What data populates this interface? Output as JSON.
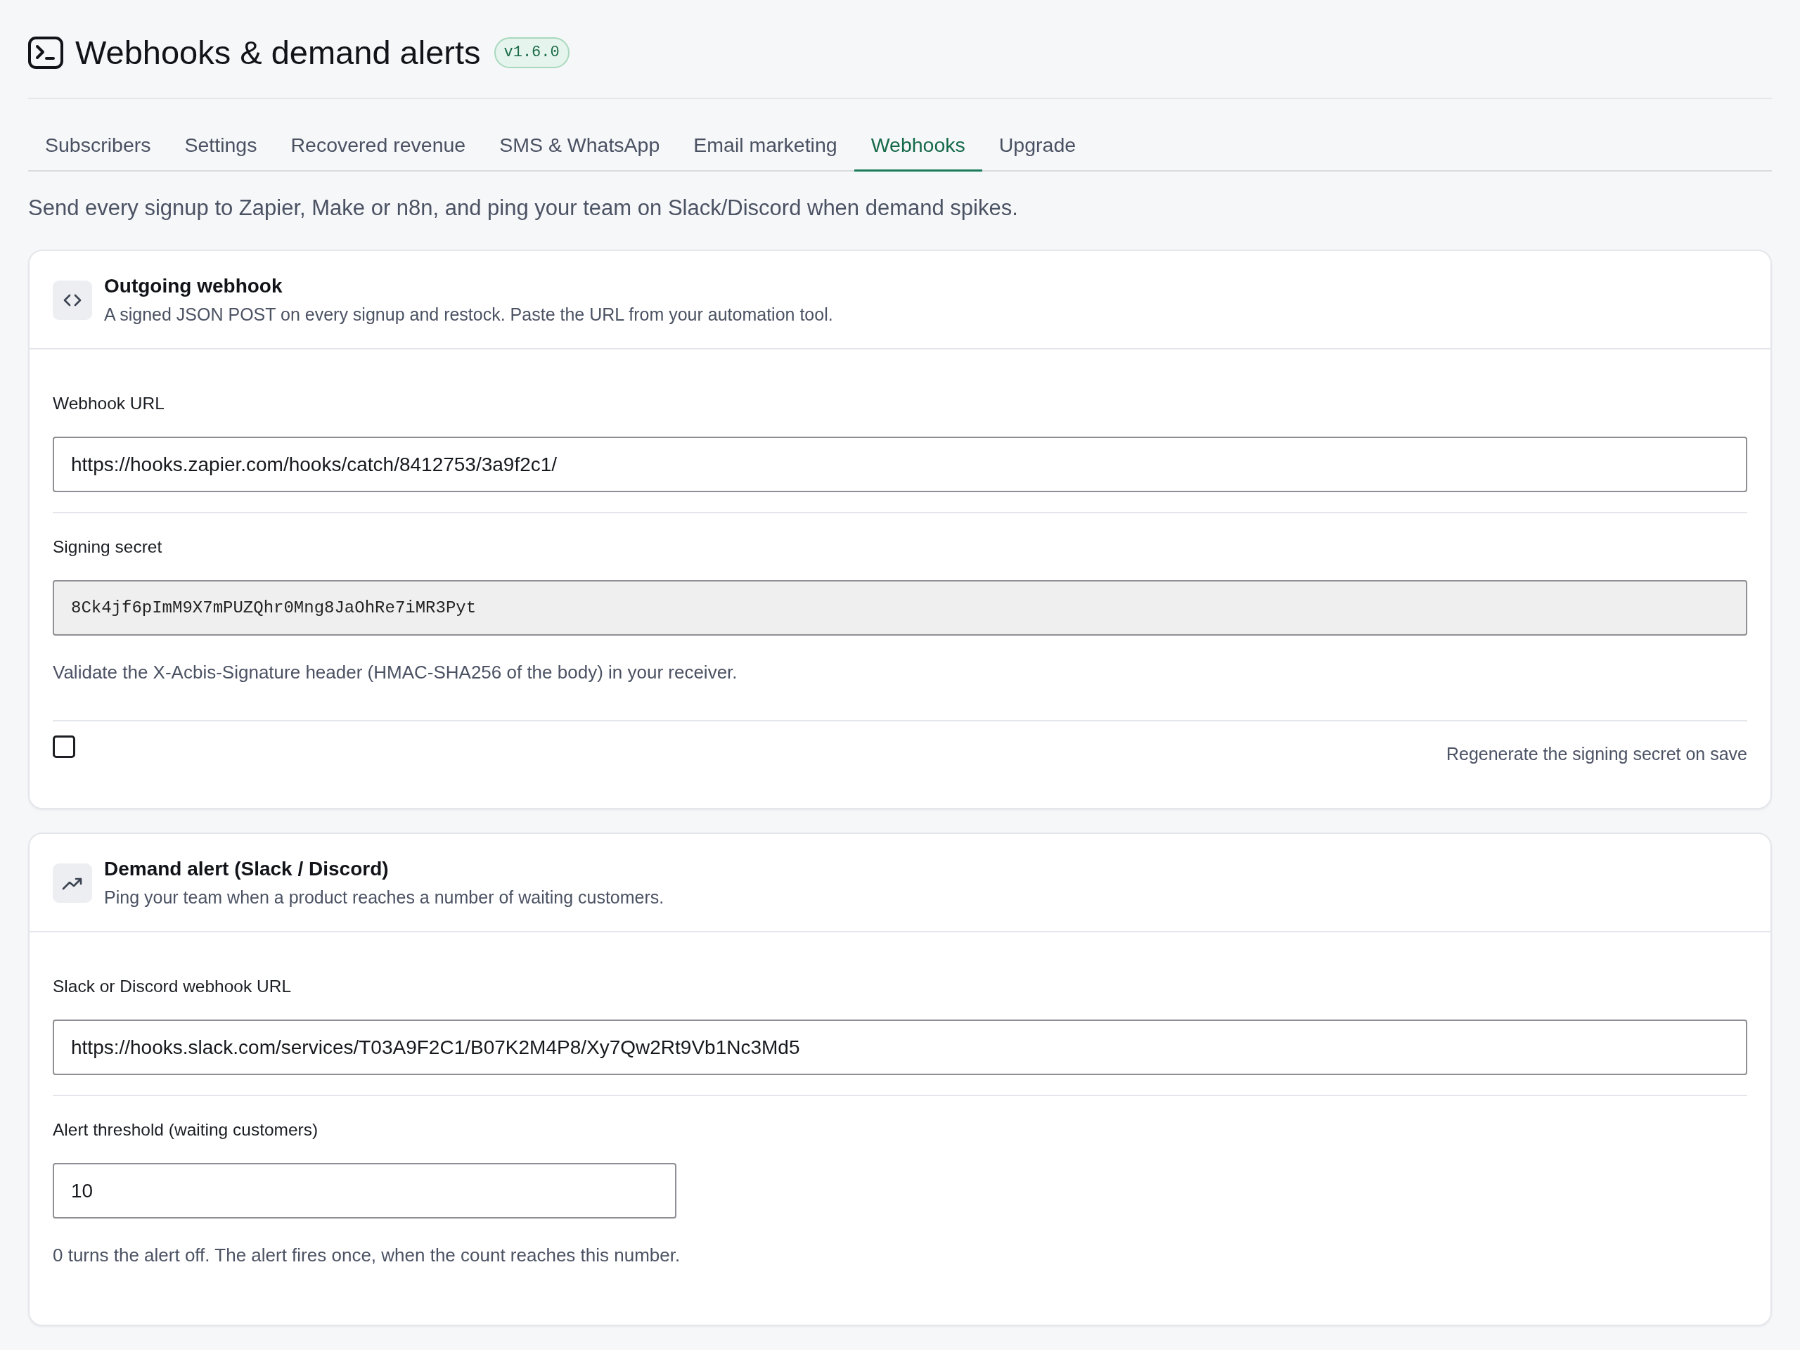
{
  "header": {
    "title": "Webhooks & demand alerts",
    "version": "v1.6.0"
  },
  "tabs": [
    {
      "label": "Subscribers",
      "selected": false
    },
    {
      "label": "Settings",
      "selected": false
    },
    {
      "label": "Recovered revenue",
      "selected": false
    },
    {
      "label": "SMS & WhatsApp",
      "selected": false
    },
    {
      "label": "Email marketing",
      "selected": false
    },
    {
      "label": "Webhooks",
      "selected": true
    },
    {
      "label": "Upgrade",
      "selected": false
    }
  ],
  "description": "Send every signup to Zapier, Make or n8n, and ping your team on Slack/Discord when demand spikes.",
  "cards": [
    {
      "title": "Outgoing webhook",
      "subtitle": "A signed JSON POST on every signup and restock. Paste the URL from your automation tool.",
      "fields": [
        {
          "kind": "text",
          "label": "Webhook URL",
          "value": "https://hooks.zapier.com/hooks/catch/8412753/3a9f2c1/"
        },
        {
          "kind": "secret",
          "label": "Signing secret",
          "value": "8Ck4jf6pImM9X7mPUZQhr0Mng8JaOhRe7iMR3Pyt",
          "help": "Validate the X-Acbis-Signature header (HMAC-SHA256 of the body) in your receiver."
        },
        {
          "kind": "checkbox",
          "label": "Regenerate the signing secret on save",
          "checked": false
        }
      ]
    },
    {
      "title": "Demand alert (Slack / Discord)",
      "subtitle": "Ping your team when a product reaches a number of waiting customers.",
      "fields": [
        {
          "kind": "text",
          "label": "Slack or Discord webhook URL",
          "value": "https://hooks.slack.com/services/T03A9F2C1/B07K2M4P8/Xy7Qw2Rt9Vb1Nc3Md5"
        },
        {
          "kind": "number",
          "label": "Alert threshold (waiting customers)",
          "value": "10",
          "help": "0 turns the alert off. The alert fires once, when the count reaches this number."
        }
      ]
    }
  ]
}
